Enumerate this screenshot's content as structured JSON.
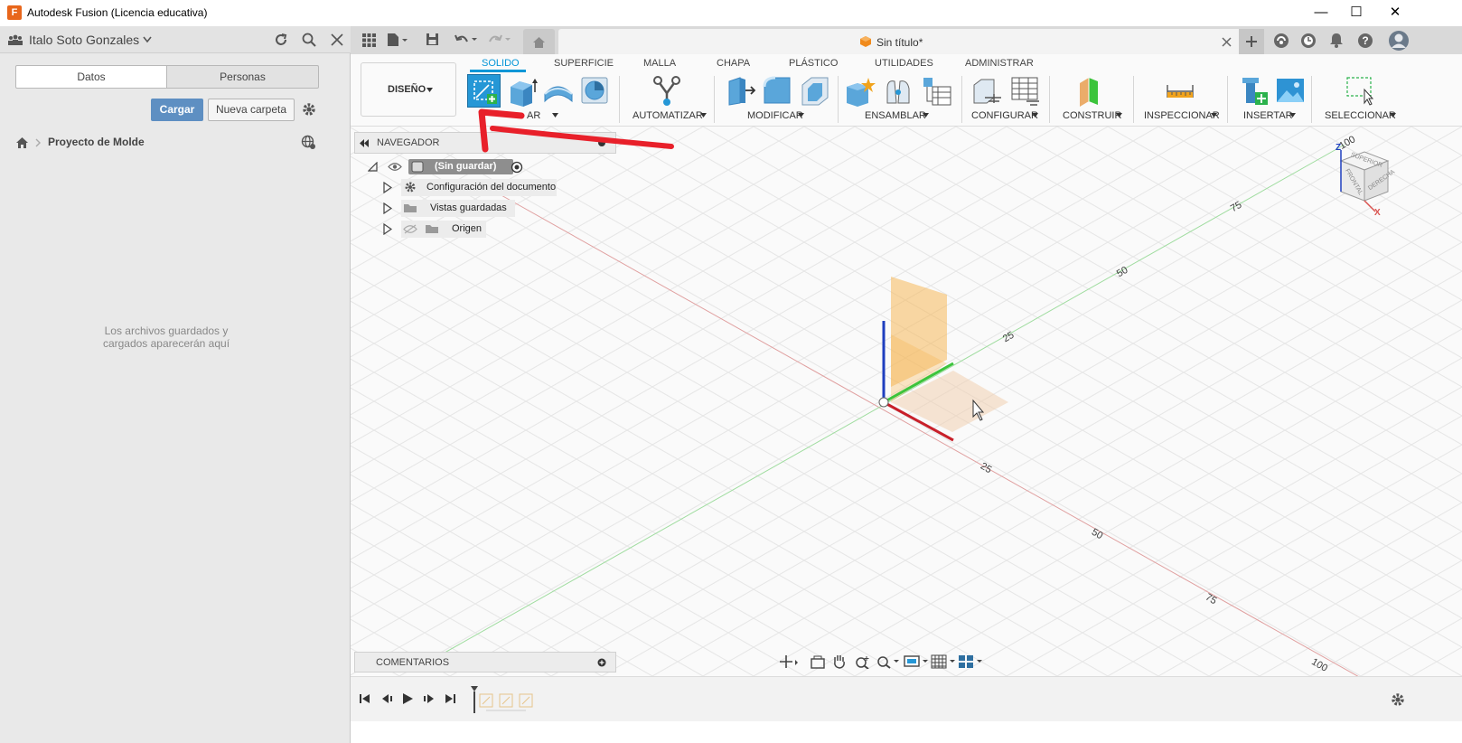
{
  "window": {
    "title": "Autodesk Fusion (Licencia educativa)",
    "minimize": "—",
    "maximize": "☐",
    "close": "✕"
  },
  "data_panel": {
    "user_name": "Italo Soto Gonzales",
    "tabs": [
      "Datos",
      "Personas"
    ],
    "upload_label": "Cargar",
    "new_folder_label": "Nueva carpeta",
    "breadcrumb": "Proyecto de Molde",
    "empty_message": "Los archivos guardados y cargados aparecerán aquí"
  },
  "document_tab": {
    "title": "Sin título*"
  },
  "toolbar": {
    "workspace": "DISEÑO",
    "tabs": [
      "SOLIDO",
      "SUPERFICIE",
      "MALLA",
      "CHAPA",
      "PLÁSTICO",
      "UTILIDADES",
      "ADMINISTRAR"
    ],
    "active_tab": "SOLIDO",
    "groups": {
      "create": "AR",
      "automate": "AUTOMATIZAR",
      "modify": "MODIFICAR",
      "assemble": "ENSAMBLAR",
      "configure": "CONFIGURAR",
      "construct": "CONSTRUIR",
      "inspect": "INSPECCIONAR",
      "insert": "INSERTAR",
      "select": "SELECCIONAR"
    }
  },
  "navigator": {
    "title": "NAVEGADOR",
    "root": "(Sin guardar)",
    "items": [
      "Configuración del documento",
      "Vistas guardadas",
      "Origen"
    ]
  },
  "comments": {
    "title": "COMENTARIOS"
  },
  "viewcube": {
    "top": "SUPERIOR",
    "front": "FRONTAL",
    "right": "DERECHA",
    "axis_z": "Z",
    "axis_x": "X"
  },
  "grid_labels": {
    "green_axis": [
      "25",
      "50",
      "75",
      "100"
    ],
    "red_axis": [
      "25",
      "50",
      "75",
      "100"
    ]
  },
  "colors": {
    "accent": "#0696d7",
    "primary_button": "#5e8fc2",
    "annotation_arrow": "#e8202a",
    "x_axis": "#d9534f",
    "y_axis": "#3cc43c",
    "z_axis": "#1f3fbf",
    "plane": "#f6b85a"
  }
}
